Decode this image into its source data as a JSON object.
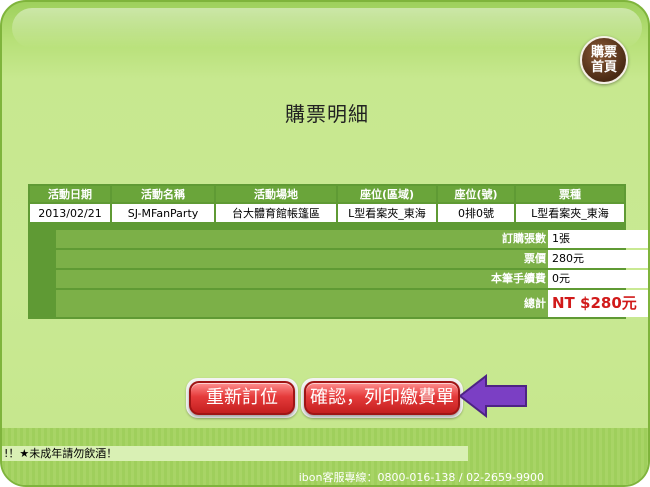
{
  "page": {
    "title": "購票明細"
  },
  "home_button": {
    "label": "購票首頁"
  },
  "table": {
    "headers": [
      "活動日期",
      "活動名稱",
      "活動場地",
      "座位(區域)",
      "座位(號)",
      "票種"
    ],
    "row": [
      "2013/02/21",
      "SJ-MFanParty",
      "台大體育館帳篷區",
      "L型看案夾_東海",
      "0排0號",
      "L型看案夾_東海"
    ]
  },
  "summary": {
    "tickets_label": "訂購張數",
    "tickets_value": "1張",
    "price_label": "票價",
    "price_value": "280元",
    "fee_label": "本筆手續費",
    "fee_value": "0元",
    "total_label": "總計",
    "total_value": "NT $280元"
  },
  "buttons": {
    "reorder": "重新訂位",
    "confirm": "確認，列印繳費單"
  },
  "footer": {
    "notice": "!！★未成年請勿飲酒！",
    "hotline": "ibon客服專線：0800-016-138 / 02-2659-9900"
  },
  "colors": {
    "accent_red": "#d11a1a",
    "arrow_purple": "#7b3fc4",
    "panel_green": "#c9e993"
  }
}
